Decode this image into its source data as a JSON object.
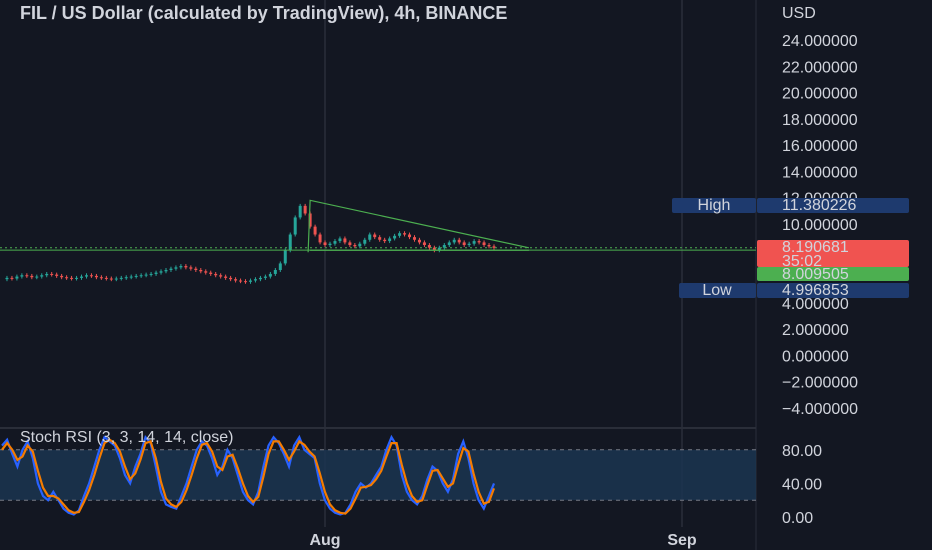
{
  "header": {
    "title": "FIL / US Dollar (calculated by TradingView), 4h, BINANCE",
    "currency": "USD"
  },
  "colors": {
    "background": "#131722",
    "grid": "#2a2e39",
    "up": "#26a69a",
    "down": "#ef5350",
    "triangle": "#4caf50",
    "hline": "#4caf50",
    "high_low_label_bg": "#1e3a6e",
    "price_label_bg": "#f05350",
    "ref_label_bg": "#4caf50",
    "stoch_k": "#2962ff",
    "stoch_d": "#f57c00",
    "stoch_band": "#1b3550"
  },
  "price_axis": {
    "ticks": [
      "24.000000",
      "22.000000",
      "20.000000",
      "18.000000",
      "16.000000",
      "14.000000",
      "12.000000",
      "10.000000",
      "4.000000",
      "2.000000",
      "0.000000",
      "−2.000000",
      "−4.000000"
    ],
    "tick_values": [
      24,
      22,
      20,
      18,
      16,
      14,
      12,
      10,
      4,
      2,
      0,
      -2,
      -4
    ]
  },
  "time_axis": {
    "labels": [
      "Aug",
      "Sep"
    ]
  },
  "markers": {
    "high_label": "High",
    "high_value": "11.380226",
    "low_label": "Low",
    "low_value": "4.996853",
    "last_price": "8.190681",
    "countdown": "35:02",
    "ref_price": "8.009505"
  },
  "stoch": {
    "title": "Stoch RSI (3, 3, 14, 14, close)",
    "ticks": [
      "80.00",
      "40.00",
      "0.00"
    ],
    "tick_values": [
      80,
      40,
      0
    ],
    "upper_band": 80,
    "lower_band": 20
  },
  "chart_data": [
    {
      "type": "candlestick",
      "title": "FIL / US Dollar (calculated by TradingView), 4h, BINANCE",
      "ylabel": "USD",
      "ylim": [
        -5,
        26
      ],
      "x_labels": [
        "Aug",
        "Sep"
      ],
      "series": [
        {
          "name": "price",
          "values": [
            5.8,
            5.9,
            5.85,
            6.0,
            6.1,
            6.05,
            5.95,
            6.0,
            6.1,
            6.2,
            6.15,
            6.05,
            5.95,
            5.9,
            5.85,
            5.9,
            6.0,
            6.1,
            6.05,
            5.95,
            5.9,
            5.85,
            5.8,
            5.85,
            5.9,
            5.95,
            6.0,
            6.05,
            6.1,
            6.15,
            6.2,
            6.3,
            6.4,
            6.5,
            6.6,
            6.7,
            6.8,
            6.7,
            6.6,
            6.5,
            6.4,
            6.3,
            6.2,
            6.1,
            6.0,
            5.9,
            5.8,
            5.7,
            5.65,
            5.6,
            5.7,
            5.8,
            5.9,
            6.0,
            6.2,
            6.5,
            7.0,
            8.0,
            9.2,
            10.5,
            11.38,
            10.8,
            9.8,
            9.2,
            8.6,
            8.4,
            8.5,
            8.7,
            8.9,
            8.6,
            8.4,
            8.3,
            8.5,
            8.8,
            9.2,
            9.0,
            8.8,
            8.7,
            8.9,
            9.1,
            9.3,
            9.2,
            9.0,
            8.8,
            8.6,
            8.4,
            8.2,
            8.0,
            8.2,
            8.4,
            8.6,
            8.8,
            8.6,
            8.4,
            8.5,
            8.7,
            8.6,
            8.4,
            8.3,
            8.19
          ]
        },
        {
          "name": "triangle_upper",
          "values": [
            [
              62,
              11.8
            ],
            [
              102,
              8.19
            ]
          ]
        },
        {
          "name": "triangle_lower",
          "values": [
            [
              62,
              8.0
            ],
            [
              102,
              8.0
            ]
          ]
        }
      ],
      "levels": {
        "high": 11.380226,
        "low": 4.996853,
        "last": 8.190681,
        "ref": 8.009505
      }
    },
    {
      "type": "line",
      "title": "Stoch RSI (3, 3, 14, 14, close)",
      "ylim": [
        0,
        100
      ],
      "series": [
        {
          "name": "K",
          "values": [
            85,
            92,
            75,
            60,
            80,
            90,
            70,
            40,
            25,
            20,
            30,
            20,
            10,
            5,
            3,
            8,
            25,
            40,
            60,
            80,
            95,
            90,
            85,
            70,
            50,
            40,
            60,
            75,
            95,
            88,
            60,
            30,
            15,
            12,
            10,
            25,
            40,
            60,
            80,
            90,
            85,
            70,
            50,
            60,
            80,
            70,
            50,
            30,
            20,
            15,
            30,
            60,
            85,
            95,
            88,
            75,
            60,
            85,
            95,
            80,
            75,
            70,
            40,
            20,
            10,
            5,
            3,
            5,
            15,
            30,
            40,
            35,
            40,
            50,
            60,
            80,
            95,
            85,
            50,
            30,
            20,
            15,
            25,
            45,
            60,
            55,
            40,
            30,
            45,
            75,
            90,
            70,
            40,
            20,
            10,
            25,
            40
          ]
        },
        {
          "name": "D",
          "values": [
            80,
            88,
            80,
            68,
            72,
            85,
            78,
            55,
            35,
            25,
            25,
            22,
            15,
            8,
            5,
            6,
            18,
            32,
            50,
            70,
            88,
            92,
            88,
            78,
            60,
            45,
            52,
            68,
            88,
            90,
            70,
            42,
            22,
            15,
            12,
            18,
            32,
            50,
            70,
            86,
            88,
            78,
            60,
            56,
            72,
            74,
            58,
            40,
            25,
            18,
            24,
            48,
            75,
            90,
            90,
            80,
            68,
            78,
            90,
            86,
            78,
            72,
            52,
            30,
            15,
            8,
            5,
            4,
            10,
            22,
            35,
            36,
            38,
            45,
            55,
            72,
            88,
            88,
            62,
            40,
            25,
            18,
            20,
            38,
            55,
            56,
            46,
            36,
            40,
            62,
            82,
            78,
            52,
            30,
            16,
            18,
            34
          ]
        }
      ]
    }
  ]
}
